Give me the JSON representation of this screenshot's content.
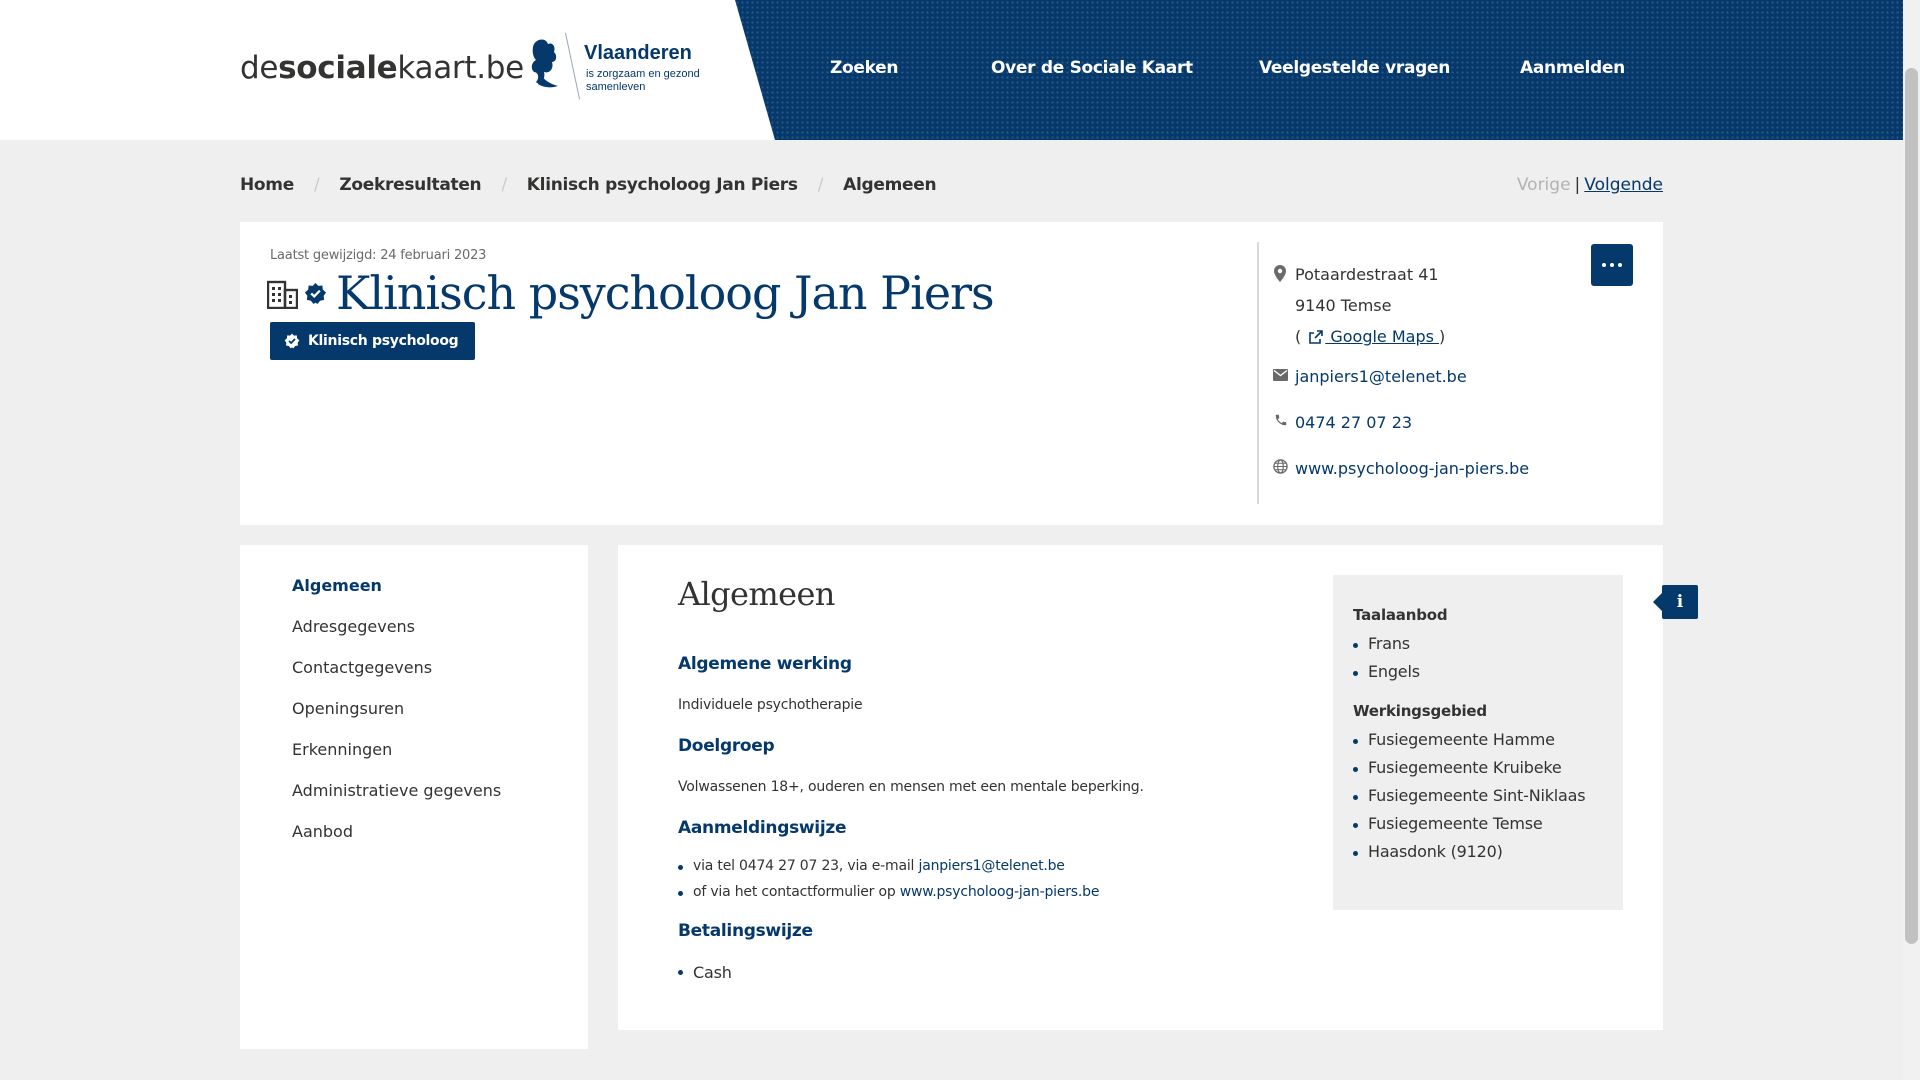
{
  "header": {
    "logo": {
      "pre": "de",
      "bold": "sociale",
      "post": "kaart.be"
    },
    "vlaanderen": {
      "title": "Vlaanderen",
      "subtitle": "is zorgzaam en gezond samenleven"
    },
    "nav": [
      "Zoeken",
      "Over de Sociale Kaart",
      "Veelgestelde vragen",
      "Aanmelden"
    ]
  },
  "breadcrumb": [
    "Home",
    "Zoekresultaten",
    "Klinisch psycholoog Jan Piers",
    "Algemeen"
  ],
  "pager": {
    "prev": "Vorige",
    "separator": "|",
    "next": "Volgende"
  },
  "profile": {
    "last_modified": "Laatst gewijzigd: 24 februari 2023",
    "title": "Klinisch psycholoog Jan Piers",
    "badge": "Klinisch psycholoog",
    "address_line1": "Potaardestraat 41",
    "address_line2": "9140 Temse",
    "maps_open": "(",
    "maps_label": " Google Maps ",
    "maps_close": ")",
    "email": "janpiers1@telenet.be",
    "phone": "0474 27 07 23",
    "website": "www.psycholoog-jan-piers.be"
  },
  "side_nav": [
    "Algemeen",
    "Adresgegevens",
    "Contactgegevens",
    "Openingsuren",
    "Erkenningen",
    "Administratieve gegevens",
    "Aanbod"
  ],
  "content": {
    "title": "Algemeen",
    "algemene_werking": {
      "heading": "Algemene werking",
      "text": "Individuele psychotherapie"
    },
    "doelgroep": {
      "heading": "Doelgroep",
      "text": "Volwassenen 18+, ouderen en mensen met een mentale beperking."
    },
    "aanmeldingswijze": {
      "heading": "Aanmeldingswijze",
      "item1_text": "via tel 0474 27 07 23, via e-mail ",
      "item1_link": "janpiers1@telenet.be",
      "item2_text": "of via het contactformulier op ",
      "item2_link": "www.psycholoog-jan-piers.be"
    },
    "betalingswijze": {
      "heading": "Betalingswijze",
      "items": [
        "Cash"
      ]
    }
  },
  "aside": {
    "taalaanbod": {
      "heading": "Taalaanbod",
      "items": [
        "Frans",
        "Engels"
      ]
    },
    "werkingsgebied": {
      "heading": "Werkingsgebied",
      "items": [
        "Fusiegemeente Hamme",
        "Fusiegemeente Kruibeke",
        "Fusiegemeente Sint-Niklaas",
        "Fusiegemeente Temse",
        "Haasdonk (9120)"
      ]
    }
  },
  "info_button": "i",
  "colors": {
    "primary": "#05386b",
    "background": "#efeff0",
    "text": "#333332"
  }
}
